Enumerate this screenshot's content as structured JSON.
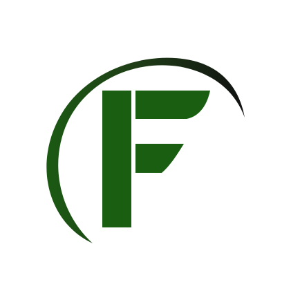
{
  "logo": {
    "letter": "F",
    "colors": {
      "letter_green": "#1a5e12",
      "arc_dark": "#111111",
      "arc_green": "#1b5a13",
      "background": "#ffffff"
    }
  }
}
